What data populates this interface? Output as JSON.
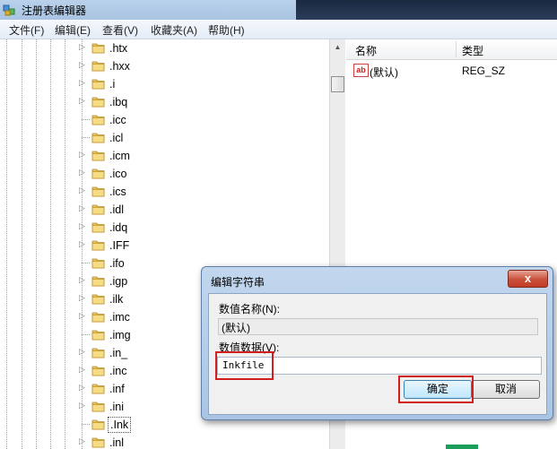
{
  "window": {
    "title": "注册表编辑器"
  },
  "menu": [
    "文件(F)",
    "编辑(E)",
    "查看(V)",
    "收藏夹(A)",
    "帮助(H)"
  ],
  "tree": [
    {
      "label": ".htx",
      "expandable": true
    },
    {
      "label": ".hxx",
      "expandable": true
    },
    {
      "label": ".i",
      "expandable": true
    },
    {
      "label": ".ibq",
      "expandable": true
    },
    {
      "label": ".icc",
      "expandable": false
    },
    {
      "label": ".icl",
      "expandable": false
    },
    {
      "label": ".icm",
      "expandable": true
    },
    {
      "label": ".ico",
      "expandable": true
    },
    {
      "label": ".ics",
      "expandable": true
    },
    {
      "label": ".idl",
      "expandable": true
    },
    {
      "label": ".idq",
      "expandable": true
    },
    {
      "label": ".IFF",
      "expandable": true
    },
    {
      "label": ".ifo",
      "expandable": false
    },
    {
      "label": ".igp",
      "expandable": true
    },
    {
      "label": ".ilk",
      "expandable": true
    },
    {
      "label": ".imc",
      "expandable": true
    },
    {
      "label": ".img",
      "expandable": false
    },
    {
      "label": ".in_",
      "expandable": true
    },
    {
      "label": ".inc",
      "expandable": true
    },
    {
      "label": ".inf",
      "expandable": true
    },
    {
      "label": ".ini",
      "expandable": true
    },
    {
      "label": ".Ink",
      "expandable": false,
      "selected": true
    },
    {
      "label": ".inl",
      "expandable": true
    }
  ],
  "list": {
    "col_name": "名称",
    "col_type": "类型",
    "rows": [
      {
        "name": "(默认)",
        "type": "REG_SZ",
        "icon": "string-value-icon",
        "icon_text": "ab"
      }
    ]
  },
  "dialog": {
    "title": "编辑字符串",
    "close": "x",
    "name_label": "数值名称(N):",
    "name_value": "(默认)",
    "data_label": "数值数据(V):",
    "data_value": "Inkfile",
    "ok": "确定",
    "cancel": "取消"
  },
  "colors": {
    "highlight": "#d01e1e",
    "titlebar": "#b9d1ea"
  }
}
